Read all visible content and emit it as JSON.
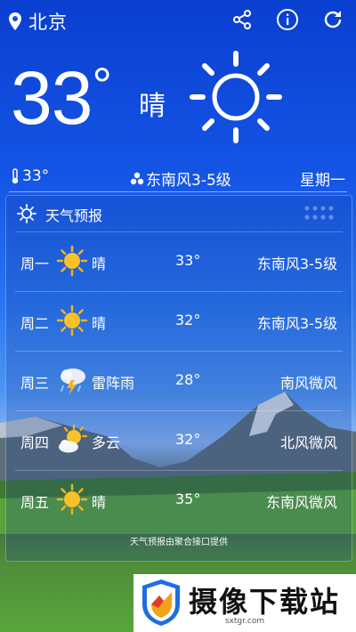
{
  "location": {
    "city": "北京"
  },
  "current": {
    "temperature": "33",
    "degree": "°",
    "condition": "晴"
  },
  "stats": {
    "temp": "33°",
    "wind": "东南风3-5级",
    "weekday": "星期一"
  },
  "forecast": {
    "title": "天气预报",
    "days": [
      {
        "day": "周一",
        "icon": "sun-icon",
        "condition": "晴",
        "temp": "33°",
        "wind": "东南风3-5级"
      },
      {
        "day": "周二",
        "icon": "sun-icon",
        "condition": "晴",
        "temp": "32°",
        "wind": "东南风3-5级"
      },
      {
        "day": "周三",
        "icon": "thunder-rain-icon",
        "condition": "雷阵雨",
        "temp": "28°",
        "wind": "南风微风"
      },
      {
        "day": "周四",
        "icon": "partly-cloudy-icon",
        "condition": "多云",
        "temp": "32°",
        "wind": "北风微风"
      },
      {
        "day": "周五",
        "icon": "sun-icon",
        "condition": "晴",
        "temp": "35°",
        "wind": "东南风微风"
      }
    ],
    "footer": "天气预报由聚合接口提供"
  },
  "banner": {
    "name": "摄像下载站",
    "url": "sxtgr.com"
  },
  "colors": {
    "sun": "#f5b21a",
    "bgTop": "#0a3fd0",
    "grass": "#58a63a"
  }
}
